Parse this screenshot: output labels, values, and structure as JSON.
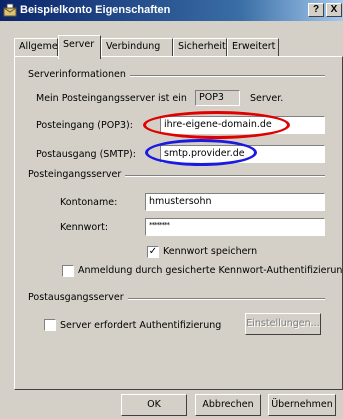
{
  "window": {
    "title": "Beispielkonto Eigenschaften",
    "help_label": "?",
    "close_label": "X"
  },
  "tabs": [
    "Allgemein",
    "Server",
    "Verbindung",
    "Sicherheit",
    "Erweitert"
  ],
  "active_tab": "Server",
  "server_info": {
    "group_label": "Serverinformationen",
    "incoming_type_prefix": "Mein Posteingangsserver ist ein",
    "incoming_type_value": "POP3",
    "incoming_type_suffix": "Server.",
    "incoming_label": "Posteingang (POP3):",
    "incoming_value": "ihre-eigene-domain.de",
    "outgoing_label": "Postausgang (SMTP):",
    "outgoing_value": "smtp.provider.de"
  },
  "incoming_server": {
    "group_label": "Posteingangsserver",
    "account_label": "Kontoname:",
    "account_value": "hmustersohn",
    "password_label": "Kennwort:",
    "password_value": "********",
    "save_password_label": "Kennwort speichern",
    "save_password_checked": true,
    "spa_label": "Anmeldung durch gesicherte Kennwort-Authentifizierung",
    "spa_checked": false
  },
  "outgoing_server": {
    "group_label": "Postausgangsserver",
    "auth_label": "Server erfordert Authentifizierung",
    "auth_checked": false,
    "settings_button": "Einstellungen..."
  },
  "buttons": {
    "ok": "OK",
    "cancel": "Abbrechen",
    "apply": "Übernehmen"
  },
  "annotation_colors": {
    "incoming": "#e00000",
    "outgoing": "#1a1ae0"
  }
}
